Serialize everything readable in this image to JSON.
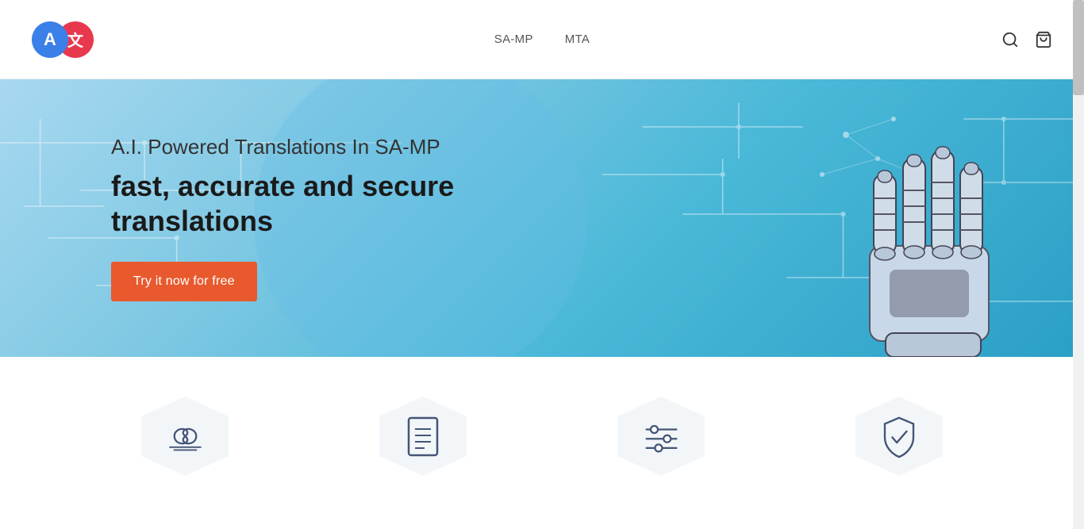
{
  "header": {
    "logo_a": "A",
    "logo_zh": "文",
    "nav": [
      {
        "label": "SA-MP",
        "id": "nav-samp"
      },
      {
        "label": "MTA",
        "id": "nav-mta"
      }
    ],
    "search_label": "search",
    "cart_label": "cart"
  },
  "hero": {
    "subtitle": "A.I. Powered Translations In SA-MP",
    "title": "fast, accurate and secure translations",
    "cta_button": "Try it now for free",
    "accent_color": "#e85a2e"
  },
  "features": [
    {
      "id": "unlimited",
      "icon": "infinity-icon"
    },
    {
      "id": "document",
      "icon": "document-icon"
    },
    {
      "id": "settings",
      "icon": "sliders-icon"
    },
    {
      "id": "security",
      "icon": "shield-check-icon"
    }
  ]
}
